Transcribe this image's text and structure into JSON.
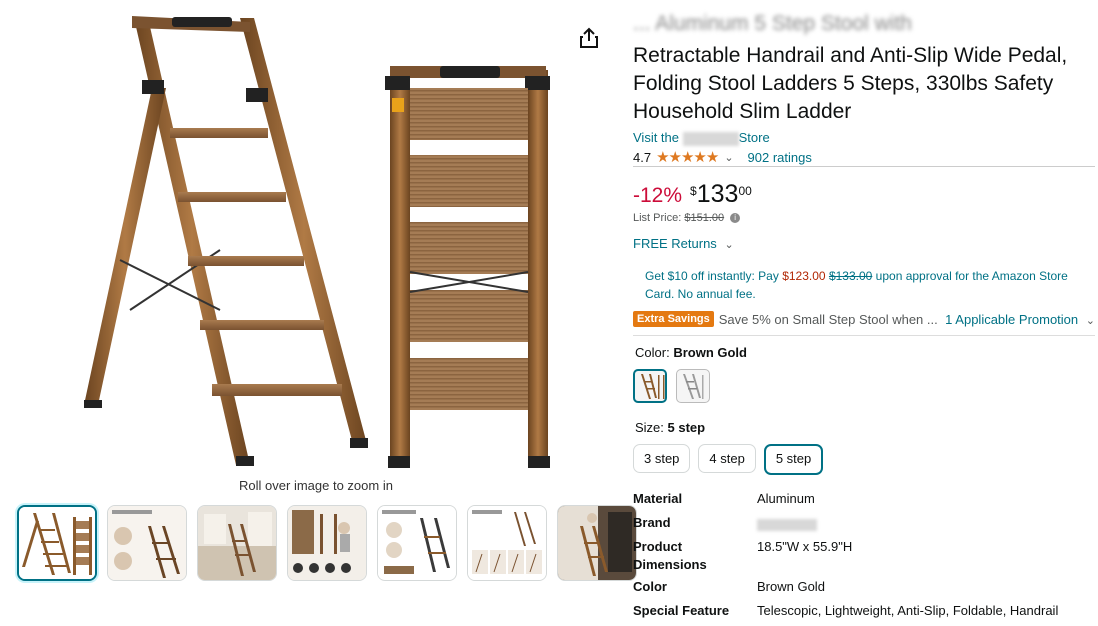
{
  "product": {
    "title_top": "... Aluminum 5 Step Stool with",
    "title": "Retractable Handrail and Anti-Slip Wide Pedal, Folding Stool Ladders 5 Steps, 330lbs Safety Household Slim Ladder",
    "visit_prefix": "Visit the",
    "visit_suffix": "Store",
    "rating_value": "4.7",
    "stars": "★★★★★",
    "rating_caret": "⌄",
    "ratings_count": "902 ratings"
  },
  "price": {
    "discount": "-12%",
    "currency": "$",
    "whole": "133",
    "fraction": "00",
    "list_label": "List Price:",
    "list_value": "$151.00",
    "info_icon": "i"
  },
  "returns": {
    "label": "FREE Returns",
    "caret": "⌄"
  },
  "offer": {
    "prefix": "Get $10 off instantly: Pay",
    "new_price": "$123.00",
    "old_price": "$133.00",
    "suffix": "upon approval for the Amazon Store Card. No annual fee."
  },
  "promo": {
    "badge": "Extra Savings",
    "text": "Save 5% on Small Step Stool when ...",
    "link": "1 Applicable Promotion",
    "caret": "⌄"
  },
  "color": {
    "label": "Color:",
    "selected": "Brown Gold"
  },
  "size": {
    "label": "Size:",
    "selected": "5 step",
    "options": [
      "3 step",
      "4 step",
      "5 step"
    ]
  },
  "specs": [
    {
      "k": "Material",
      "v": "Aluminum"
    },
    {
      "k": "Brand",
      "v": ""
    },
    {
      "k": "Product Dimensions",
      "v": "18.5\"W x 55.9\"H"
    },
    {
      "k": "Color",
      "v": "Brown Gold"
    },
    {
      "k": "Special Feature",
      "v": "Telescopic, Lightweight, Anti-Slip, Foldable, Handrail"
    }
  ],
  "gallery": {
    "zoom_hint": "Roll over image to zoom in"
  },
  "colors": {
    "brand_teal": "#007185",
    "price_red": "#cc0c39",
    "star_orange": "#de7921",
    "ladder_bronze": "#8a5a2b"
  }
}
